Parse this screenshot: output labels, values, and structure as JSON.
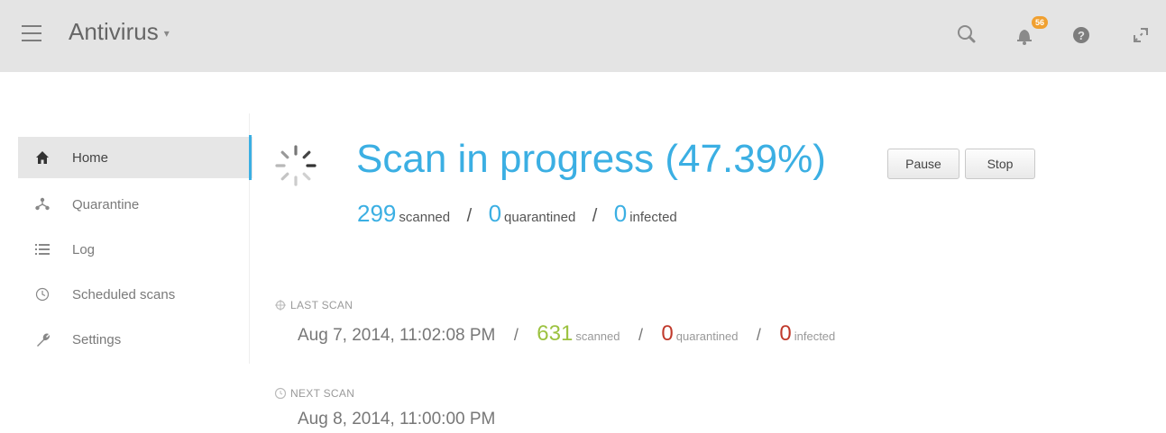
{
  "app": {
    "title": "Antivirus",
    "title_caret": "▾"
  },
  "header": {
    "notification_count": "56",
    "icons": [
      "search-icon",
      "bell-icon",
      "help-icon",
      "expand-icon"
    ]
  },
  "sidebar": {
    "items": [
      {
        "label": "Home",
        "icon": "home-icon",
        "active": true
      },
      {
        "label": "Quarantine",
        "icon": "quarantine-icon",
        "active": false
      },
      {
        "label": "Log",
        "icon": "list-icon",
        "active": false
      },
      {
        "label": "Scheduled scans",
        "icon": "clock-icon",
        "active": false
      },
      {
        "label": "Settings",
        "icon": "wrench-icon",
        "active": false
      }
    ]
  },
  "scan": {
    "title": "Scan in progress (47.39%)",
    "pause_label": "Pause",
    "stop_label": "Stop",
    "scanned": "299",
    "scanned_label": "scanned",
    "quarantined": "0",
    "quarantined_label": "quarantined",
    "infected": "0",
    "infected_label": "infected",
    "separator": "/"
  },
  "last_scan": {
    "label": "LAST SCAN",
    "date": "Aug 7, 2014, 11:02:08 PM",
    "scanned": "631",
    "scanned_label": "scanned",
    "quarantined": "0",
    "quarantined_label": "quarantined",
    "infected": "0",
    "infected_label": "infected",
    "separator": "/"
  },
  "next_scan": {
    "label": "NEXT SCAN",
    "date": "Aug 8, 2014, 11:00:00 PM"
  },
  "colors": {
    "accent": "#3bafe3",
    "green": "#9cc240",
    "red": "#c0392b",
    "badge": "#f0a030",
    "topbar": "#e4e4e4"
  }
}
